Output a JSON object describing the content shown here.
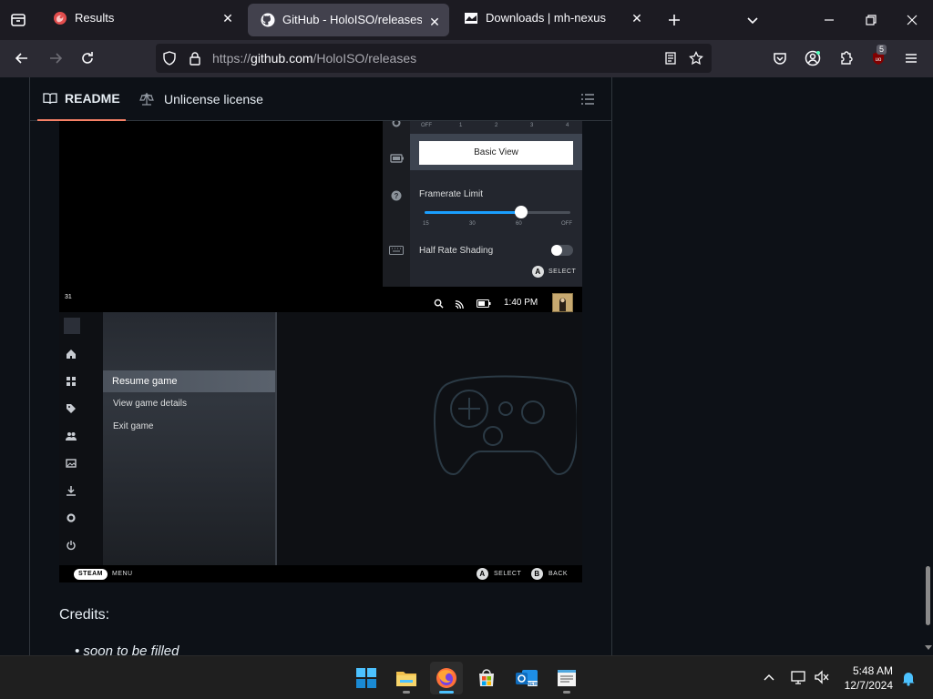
{
  "browser": {
    "tabs": [
      {
        "title": "Results",
        "favicon": "firefox-red-icon"
      },
      {
        "title": "GitHub - HoloISO/releases: To ",
        "favicon": "github-icon"
      },
      {
        "title": "Downloads | mh-nexus",
        "favicon": "mh-nexus-icon"
      }
    ],
    "url_prefix": "https://",
    "url_host": "github.com",
    "url_path": "/HoloISO/releases",
    "extension_badge": "5"
  },
  "readme": {
    "tab_readme": "README",
    "tab_license": "Unlicense license",
    "credits_heading": "Credits:",
    "credits_items": [
      "soon to be filled"
    ]
  },
  "steam_qam": {
    "upscale_ticks": [
      "OFF",
      "1",
      "2",
      "3",
      "4"
    ],
    "basic_view_button": "Basic View",
    "framerate_label": "Framerate Limit",
    "framerate_ticks": [
      "15",
      "30",
      "60",
      "OFF"
    ],
    "framerate_value_fraction": 0.66,
    "half_rate_label": "Half Rate Shading",
    "select_button_glyph": "A",
    "select_hint": "SELECT"
  },
  "steam_menu": {
    "status_number": "31",
    "time": "1:40 PM",
    "items": [
      "Resume game",
      "View game details",
      "Exit game"
    ],
    "footer_steam": "STEAM",
    "footer_menu": "MENU",
    "footer_select_glyph": "A",
    "footer_select": "SELECT",
    "footer_back_glyph": "B",
    "footer_back": "BACK"
  },
  "taskbar": {
    "time": "5:48 AM",
    "date": "12/7/2024"
  },
  "colors": {
    "accent_blue": "#1a9fff",
    "github_tab_underline": "#f78166",
    "taskbar_active": "#4cc2ff"
  }
}
